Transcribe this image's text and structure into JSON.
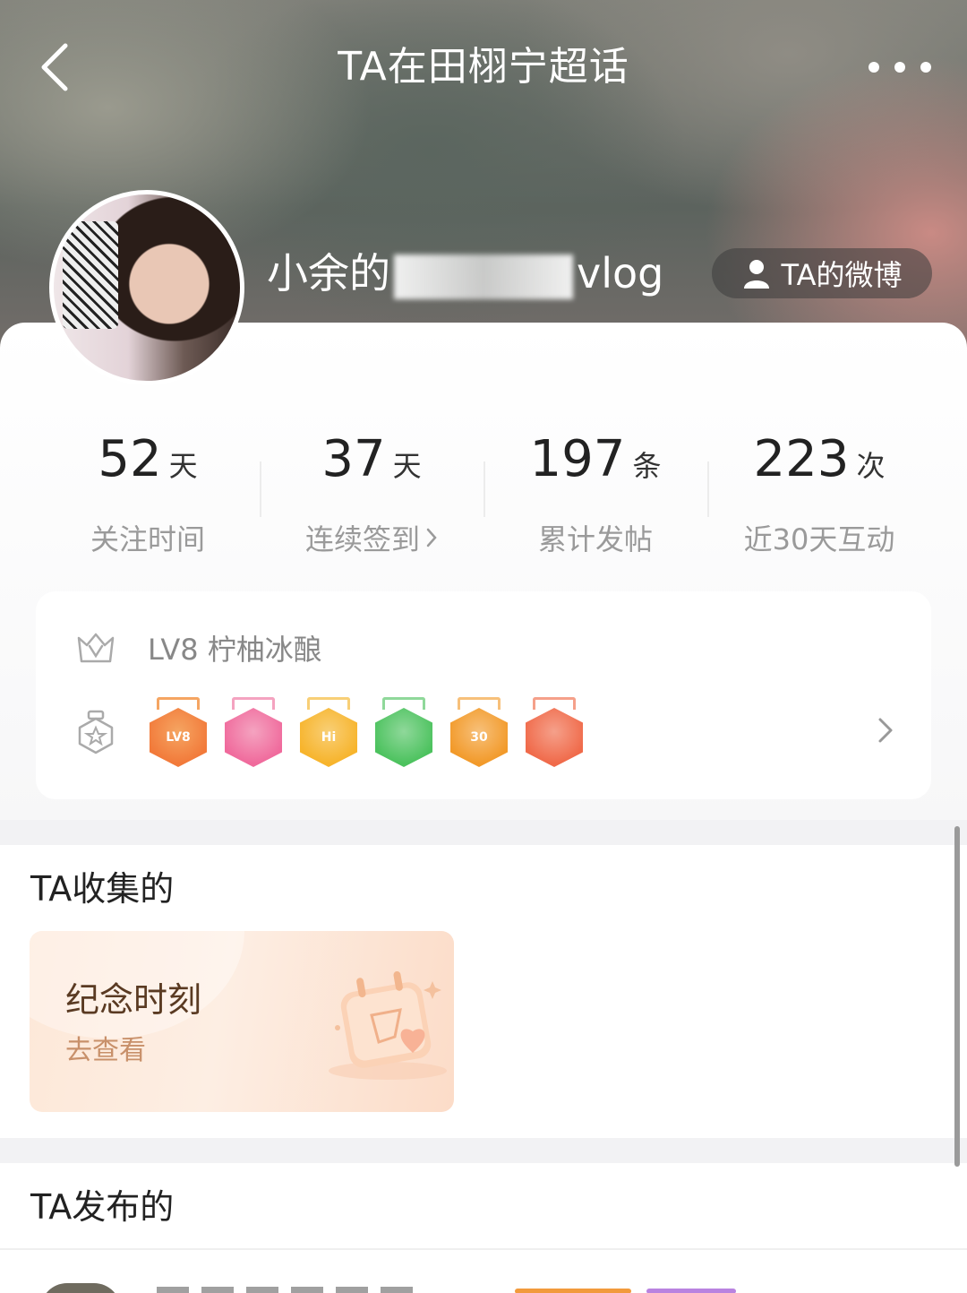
{
  "header": {
    "title": "TA在田栩宁超话",
    "back_icon": "chevron-left-icon",
    "more_icon": "more-dots-icon"
  },
  "user": {
    "name_prefix": "小余的",
    "name_suffix": "vlog",
    "weibo_button": "TA的微博",
    "weibo_icon": "person-icon"
  },
  "stats": [
    {
      "value": "52",
      "unit": "天",
      "label": "关注时间",
      "has_arrow": false
    },
    {
      "value": "37",
      "unit": "天",
      "label": "连续签到",
      "has_arrow": true
    },
    {
      "value": "197",
      "unit": "条",
      "label": "累计发帖",
      "has_arrow": false
    },
    {
      "value": "223",
      "unit": "次",
      "label": "近30天互动",
      "has_arrow": false
    }
  ],
  "level": {
    "text": "LV8 柠柚冰酿",
    "level_icon": "crown-v-icon",
    "badge_icon": "medal-icon",
    "badges": [
      {
        "name": "LV8",
        "color": "#f27a3a",
        "ribbon": "#f5a562"
      },
      {
        "name": "graduation-cap",
        "color": "#f06a9c",
        "ribbon": "#f4a3c0"
      },
      {
        "name": "Hi",
        "color": "#f7b42c",
        "ribbon": "#f8cf76"
      },
      {
        "name": "hand",
        "color": "#4cc25e",
        "ribbon": "#8fd89a"
      },
      {
        "name": "30",
        "color": "#f29a2a",
        "ribbon": "#f7c07a"
      },
      {
        "name": "rock-hand",
        "color": "#f06a4a",
        "ribbon": "#f5a08a"
      }
    ]
  },
  "collect": {
    "title": "TA收集的",
    "card_title": "纪念时刻",
    "card_sub": "去查看"
  },
  "publish": {
    "title": "TA发布的"
  },
  "colors": {
    "accent_text": "#5a3a22",
    "accent_sub": "#c8906a"
  }
}
